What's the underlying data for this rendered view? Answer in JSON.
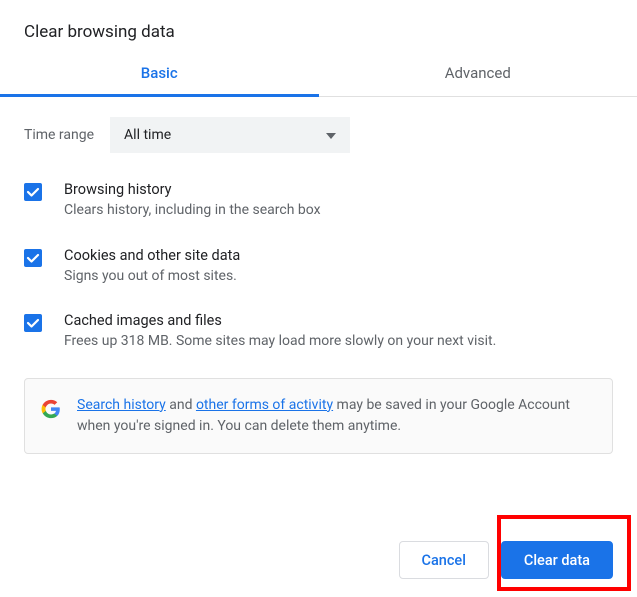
{
  "title": "Clear browsing data",
  "tabs": {
    "basic": "Basic",
    "advanced": "Advanced"
  },
  "time": {
    "label": "Time range",
    "value": "All time"
  },
  "options": [
    {
      "title": "Browsing history",
      "desc": "Clears history, including in the search box"
    },
    {
      "title": "Cookies and other site data",
      "desc": "Signs you out of most sites."
    },
    {
      "title": "Cached images and files",
      "desc": "Frees up 318 MB. Some sites may load more slowly on your next visit."
    }
  ],
  "notice": {
    "link1": "Search history",
    "mid1": " and ",
    "link2": "other forms of activity",
    "rest": " may be saved in your Google Account when you're signed in. You can delete them anytime."
  },
  "buttons": {
    "cancel": "Cancel",
    "clear": "Clear data"
  }
}
